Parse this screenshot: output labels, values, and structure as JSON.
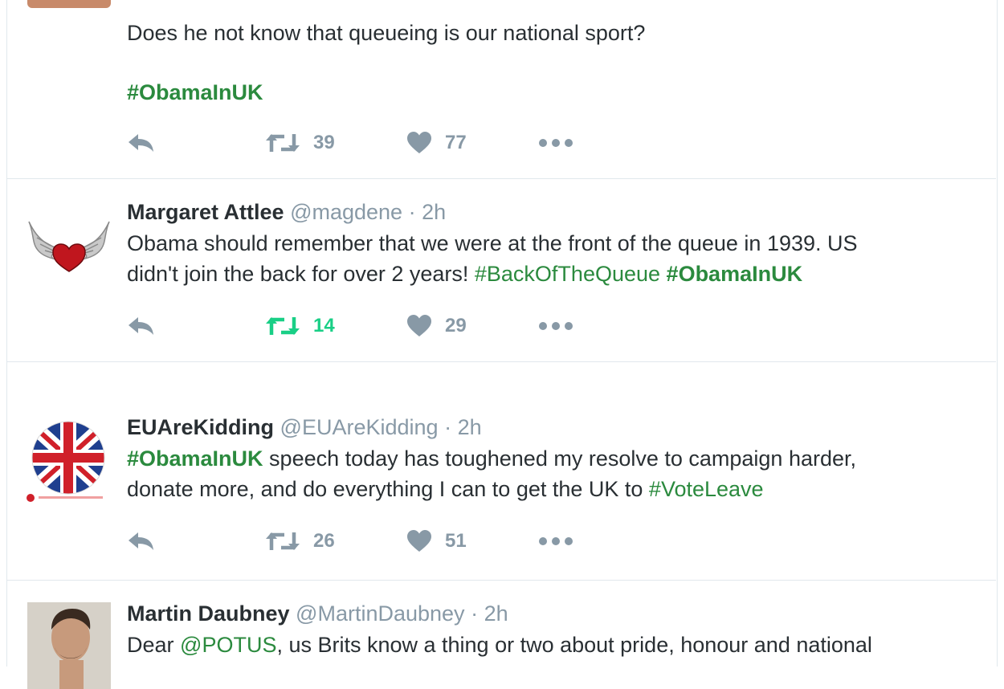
{
  "tweets": [
    {
      "text_lines": [
        [
          {
            "t": "Does he not know that queueing is our national sport?",
            "k": "plain"
          }
        ],
        [],
        [
          {
            "t": "#ObamaInUK",
            "k": "tagb"
          }
        ]
      ],
      "replies": "",
      "retweets": "39",
      "likes": "77",
      "retweeted": false
    },
    {
      "name": "Margaret Attlee",
      "handle": "@magdene",
      "dot": "·",
      "time": "2h",
      "text_lines": [
        [
          {
            "t": "Obama should remember that we were at the front of the queue in 1939. US",
            "k": "plain"
          }
        ],
        [
          {
            "t": "didn't join the back for over 2 years!  ",
            "k": "plain"
          },
          {
            "t": "#BackOfTheQueue",
            "k": "tag"
          },
          {
            "t": " ",
            "k": "plain"
          },
          {
            "t": "#ObamaInUK",
            "k": "tagb"
          }
        ]
      ],
      "retweets": "14",
      "likes": "29",
      "retweeted": true
    },
    {
      "name": "EUAreKidding",
      "handle": "@EUAreKidding",
      "dot": "·",
      "time": "2h",
      "text_lines": [
        [
          {
            "t": "#ObamaInUK",
            "k": "tagb"
          },
          {
            "t": " speech today has toughened my resolve to campaign harder,",
            "k": "plain"
          }
        ],
        [
          {
            "t": "donate more, and do everything I can to get the UK to ",
            "k": "plain"
          },
          {
            "t": "#VoteLeave",
            "k": "tag"
          }
        ]
      ],
      "retweets": "26",
      "likes": "51",
      "retweeted": false
    },
    {
      "name": "Martin Daubney",
      "handle": "@MartinDaubney",
      "dot": "·",
      "time": "2h",
      "text_lines": [
        [
          {
            "t": "Dear ",
            "k": "plain"
          },
          {
            "t": "@POTUS",
            "k": "mention"
          },
          {
            "t": ", us Brits know a thing or two about pride, honour and national",
            "k": "plain"
          }
        ]
      ]
    }
  ],
  "colors": {
    "hashtag": "#2b8a3e",
    "retweet_active": "#19cf86",
    "icon_gray": "#8899a6",
    "text": "#292f33"
  },
  "icons": {
    "reply": "reply-arrow-icon",
    "retweet": "retweet-icon",
    "like": "heart-icon",
    "more": "more-dots-icon"
  }
}
